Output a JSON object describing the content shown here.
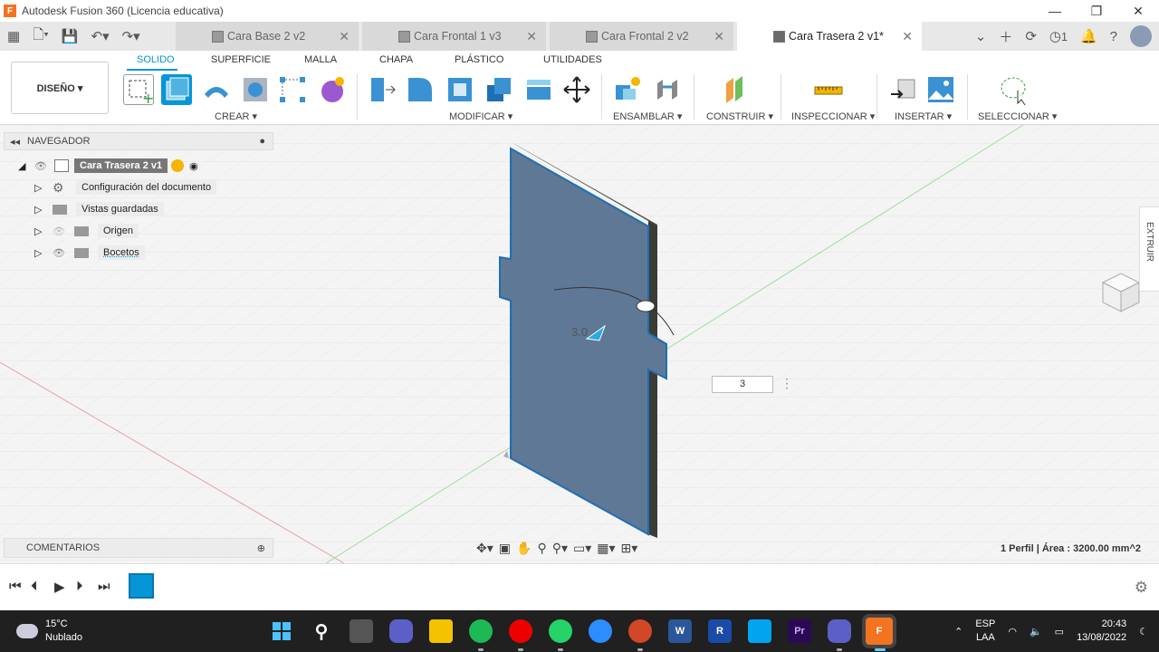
{
  "window": {
    "title": "Autodesk Fusion 360 (Licencia educativa)",
    "app_icon_letter": "F"
  },
  "tabs": [
    {
      "label": "Cara Base 2 v2",
      "active": false
    },
    {
      "label": "Cara Frontal 1 v3",
      "active": false
    },
    {
      "label": "Cara Frontal 2 v2",
      "active": false
    },
    {
      "label": "Cara Trasera 2 v1*",
      "active": true
    }
  ],
  "tabbar_right": {
    "job_count": "1"
  },
  "ribbon": {
    "workspace": "DISEÑO ▾",
    "tabs": [
      "SOLIDO",
      "SUPERFICIE",
      "MALLA",
      "CHAPA",
      "PLÁSTICO",
      "UTILIDADES"
    ],
    "groups": [
      "CREAR ▾",
      "MODIFICAR ▾",
      "ENSAMBLAR ▾",
      "CONSTRUIR ▾",
      "INSPECCIONAR ▾",
      "INSERTAR ▾",
      "SELECCIONAR ▾"
    ]
  },
  "browser": {
    "title": "NAVEGADOR",
    "root": "Cara Trasera 2 v1",
    "items": [
      "Configuración del documento",
      "Vistas guardadas",
      "Origen",
      "Bocetos"
    ]
  },
  "comments": {
    "title": "COMENTARIOS"
  },
  "viewport": {
    "dimension_value": "3",
    "dimension_label": "3.0",
    "side_panel": "EXTRUIR",
    "status": "1 Perfil | Área : 3200.00 mm^2"
  },
  "taskbar": {
    "weather_temp": "15°C",
    "weather_desc": "Nublado",
    "lang_1": "ESP",
    "lang_2": "LAA",
    "time": "20:43",
    "date": "13/08/2022",
    "app_labels": {
      "rvt": "R",
      "premiere": "Pr",
      "word": "W",
      "fusion": "F"
    }
  },
  "colors": {
    "accent": "#0696d7",
    "part_face": "#5f7896",
    "part_edge": "#4a4a44"
  }
}
